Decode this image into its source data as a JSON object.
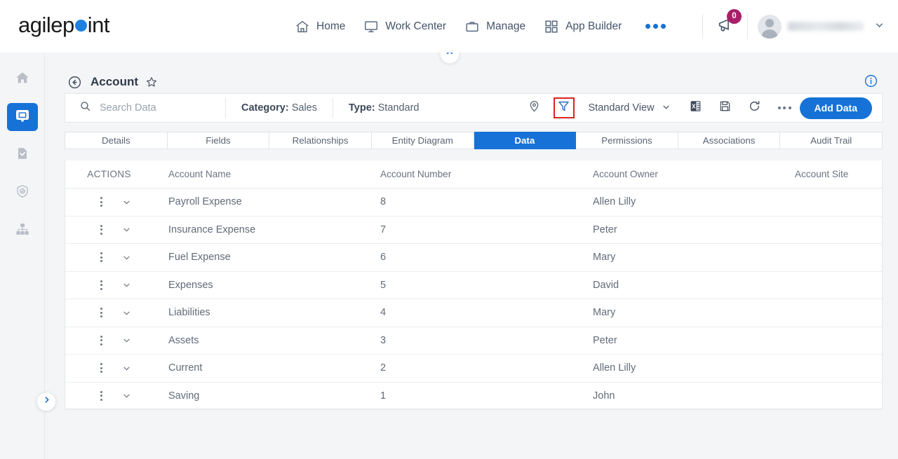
{
  "brand": {
    "name_part1": "agilep",
    "name_part2": "int",
    "dot_color": "#1f7fe0"
  },
  "topnav": {
    "items": [
      {
        "label": "Home",
        "icon": "home-icon"
      },
      {
        "label": "Work Center",
        "icon": "monitor-icon"
      },
      {
        "label": "Manage",
        "icon": "briefcase-icon"
      },
      {
        "label": "App Builder",
        "icon": "grid-icon"
      }
    ],
    "more_icon": "ellipsis-icon",
    "announcement_icon": "megaphone-icon",
    "announcement_count": "0",
    "badge_color": "#a81f68",
    "avatar_icon": "avatar-icon",
    "user_chevron_icon": "chevron-down-icon"
  },
  "sidebar": {
    "items": [
      {
        "icon": "home-icon",
        "active": false
      },
      {
        "icon": "monitor-icon",
        "active": true
      },
      {
        "icon": "document-check-icon",
        "active": false
      },
      {
        "icon": "shield-check-icon",
        "active": false
      },
      {
        "icon": "hierarchy-icon",
        "active": false
      }
    ],
    "toggle_icon": "chevron-right-icon",
    "active_color": "#1672d6"
  },
  "page": {
    "back_icon": "back-arrow-icon",
    "title": "Account",
    "favorite_icon": "star-icon",
    "info_icon": "info-icon",
    "collapse_icon": "chevron-up-icon"
  },
  "toolbar": {
    "search_placeholder": "Search Data",
    "search_value": "",
    "search_icon": "search-icon",
    "category_label": "Category:",
    "category_value": "Sales",
    "type_label": "Type:",
    "type_value": "Standard",
    "location_icon": "location-pin-icon",
    "filter_icon": "filter-funnel-icon",
    "filter_highlight_color": "#e02020",
    "view_label": "Standard View",
    "view_chevron_icon": "chevron-down-icon",
    "excel_icon": "excel-export-icon",
    "save_icon": "save-icon",
    "refresh_icon": "refresh-icon",
    "more_icon": "ellipsis-icon",
    "add_label": "Add Data",
    "accent_color": "#1672d6"
  },
  "tabs": [
    {
      "label": "Details",
      "active": false
    },
    {
      "label": "Fields",
      "active": false
    },
    {
      "label": "Relationships",
      "active": false
    },
    {
      "label": "Entity Diagram",
      "active": false
    },
    {
      "label": "Data",
      "active": true
    },
    {
      "label": "Permissions",
      "active": false
    },
    {
      "label": "Associations",
      "active": false
    },
    {
      "label": "Audit Trail",
      "active": false
    }
  ],
  "grid": {
    "columns": [
      "ACTIONS",
      "Account Name",
      "Account Number",
      "Account Owner",
      "Account Site"
    ],
    "row_menu_icon": "kebab-menu-icon",
    "row_expand_icon": "chevron-down-icon",
    "rows": [
      {
        "name": "Payroll Expense",
        "number": "8",
        "owner": "Allen Lilly",
        "site": ""
      },
      {
        "name": "Insurance Expense",
        "number": "7",
        "owner": "Peter",
        "site": ""
      },
      {
        "name": "Fuel Expense",
        "number": "6",
        "owner": "Mary",
        "site": ""
      },
      {
        "name": "Expenses",
        "number": "5",
        "owner": "David",
        "site": ""
      },
      {
        "name": "Liabilities",
        "number": "4",
        "owner": "Mary",
        "site": ""
      },
      {
        "name": "Assets",
        "number": "3",
        "owner": "Peter",
        "site": ""
      },
      {
        "name": "Current",
        "number": "2",
        "owner": "Allen Lilly",
        "site": ""
      },
      {
        "name": "Saving",
        "number": "1",
        "owner": "John",
        "site": ""
      }
    ]
  }
}
